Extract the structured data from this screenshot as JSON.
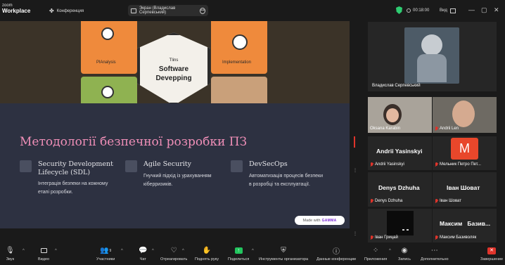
{
  "topbar": {
    "logo_line1": "zoom",
    "logo_line2": "Workplace",
    "conference_label": "Конференция",
    "screen_share_label": "Экран (Владислав Серпевський)",
    "timer": "00:18:00",
    "view_label": "Вид"
  },
  "slide": {
    "tile_labels": [
      "PlAnalysis",
      "Implementation"
    ],
    "center_small": "Tlins",
    "center_line1": "Software",
    "center_line2": "Devepping",
    "title": "Методології безпечної розробки ПЗ",
    "columns": [
      {
        "heading": [
          "Security Development",
          "Lifecycle (SDL)"
        ],
        "desc": [
          "Інтеграція безпеки на кожному",
          "етапі розробки."
        ]
      },
      {
        "heading": [
          "Agile Security"
        ],
        "desc": [
          "Гнучкий підхід із урахуванням",
          "кіберризиків."
        ]
      },
      {
        "heading": [
          "DevSecOps"
        ],
        "desc": [
          "Автоматизація процесів безпеки",
          "в розробці та експлуатації."
        ]
      }
    ],
    "made_with": "Made with",
    "made_with_brand": "GAMMA"
  },
  "participants": {
    "main_tile_name": "Владислав Серпевський",
    "tiles": [
      {
        "label": "Oksana Karabin",
        "big": ""
      },
      {
        "label": "Andrii Len",
        "big": ""
      },
      {
        "label": "Andrii Yasinskyi",
        "big": "Andrii Yasinskyi"
      },
      {
        "label": "Мельник Петро Пет...",
        "big": "",
        "avatar": "M"
      },
      {
        "label": "Denys Dzhuha",
        "big": "Denys Dzhuha"
      },
      {
        "label": "Іван Шоват",
        "big": "Іван Шоват"
      },
      {
        "label": "Іван Грицай",
        "big": ""
      },
      {
        "label": "Максим Базиволяк",
        "big": "Максим   Базив..."
      }
    ]
  },
  "toolbar": {
    "items": [
      {
        "label": "Звук",
        "icon": "microphone-icon"
      },
      {
        "label": "Видео",
        "icon": "video-camera-icon"
      },
      {
        "label": "Участники",
        "icon": "participants-icon",
        "count": "9"
      },
      {
        "label": "Чат",
        "icon": "chat-icon"
      },
      {
        "label": "Отреагировать",
        "icon": "heart-icon"
      },
      {
        "label": "Поднять руку",
        "icon": "raise-hand-icon"
      },
      {
        "label": "Поделиться",
        "icon": "share-screen-icon"
      },
      {
        "label": "Инструменты организатора",
        "icon": "shield-icon"
      },
      {
        "label": "Данные конференции",
        "icon": "info-icon"
      },
      {
        "label": "Приложения",
        "icon": "apps-icon"
      },
      {
        "label": "Запись",
        "icon": "record-icon"
      },
      {
        "label": "Дополнительно",
        "icon": "more-icon"
      },
      {
        "label": "Завершение",
        "icon": "end-call-icon"
      }
    ]
  },
  "colors": {
    "accent_pink": "#f08fb8",
    "share_green": "#22c55e",
    "end_red": "#e0342b",
    "shield_green": "#2ecc71"
  }
}
